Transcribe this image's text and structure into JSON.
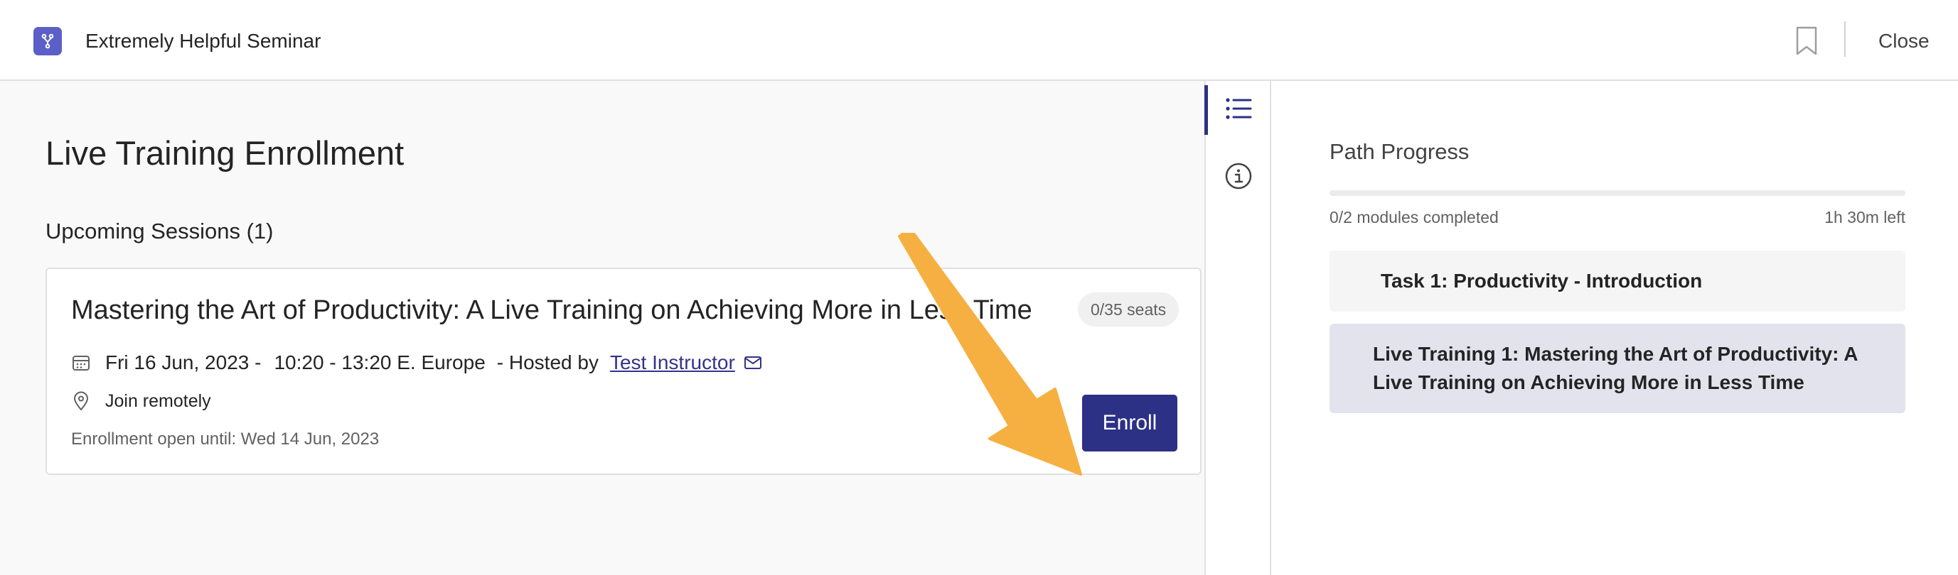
{
  "header": {
    "app_title": "Extremely Helpful Seminar",
    "close_label": "Close",
    "accent_color": "#5b5fc7"
  },
  "main": {
    "page_title": "Live Training Enrollment",
    "section_title": "Upcoming Sessions (1)",
    "session": {
      "title": "Mastering the Art of Productivity: A Live Training on Achieving More in Less Time",
      "seats": "0/35 seats",
      "date": "Fri 16 Jun, 2023 -",
      "time": "10:20 - 13:20 E. Europe",
      "hosted_by": "- Hosted by",
      "instructor": "Test Instructor",
      "location": "Join remotely",
      "enrollment_open": "Enrollment open until: Wed 14 Jun, 2023",
      "enroll_label": "Enroll",
      "enroll_color": "#2d3185"
    }
  },
  "rail": {
    "items": [
      {
        "icon": "list-icon",
        "active": true
      },
      {
        "icon": "info-icon",
        "active": false
      }
    ]
  },
  "progress": {
    "title": "Path Progress",
    "completed_text": "0/2 modules completed",
    "time_left": "1h 30m left",
    "fraction": 0,
    "modules": [
      {
        "label": "Task 1: Productivity - Introduction",
        "selected": false
      },
      {
        "label": "Live Training 1: Mastering the Art of Productivity: A Live Training on Achieving More in Less Time",
        "selected": true
      }
    ]
  },
  "annotation": {
    "arrow_color": "#f5b041"
  }
}
